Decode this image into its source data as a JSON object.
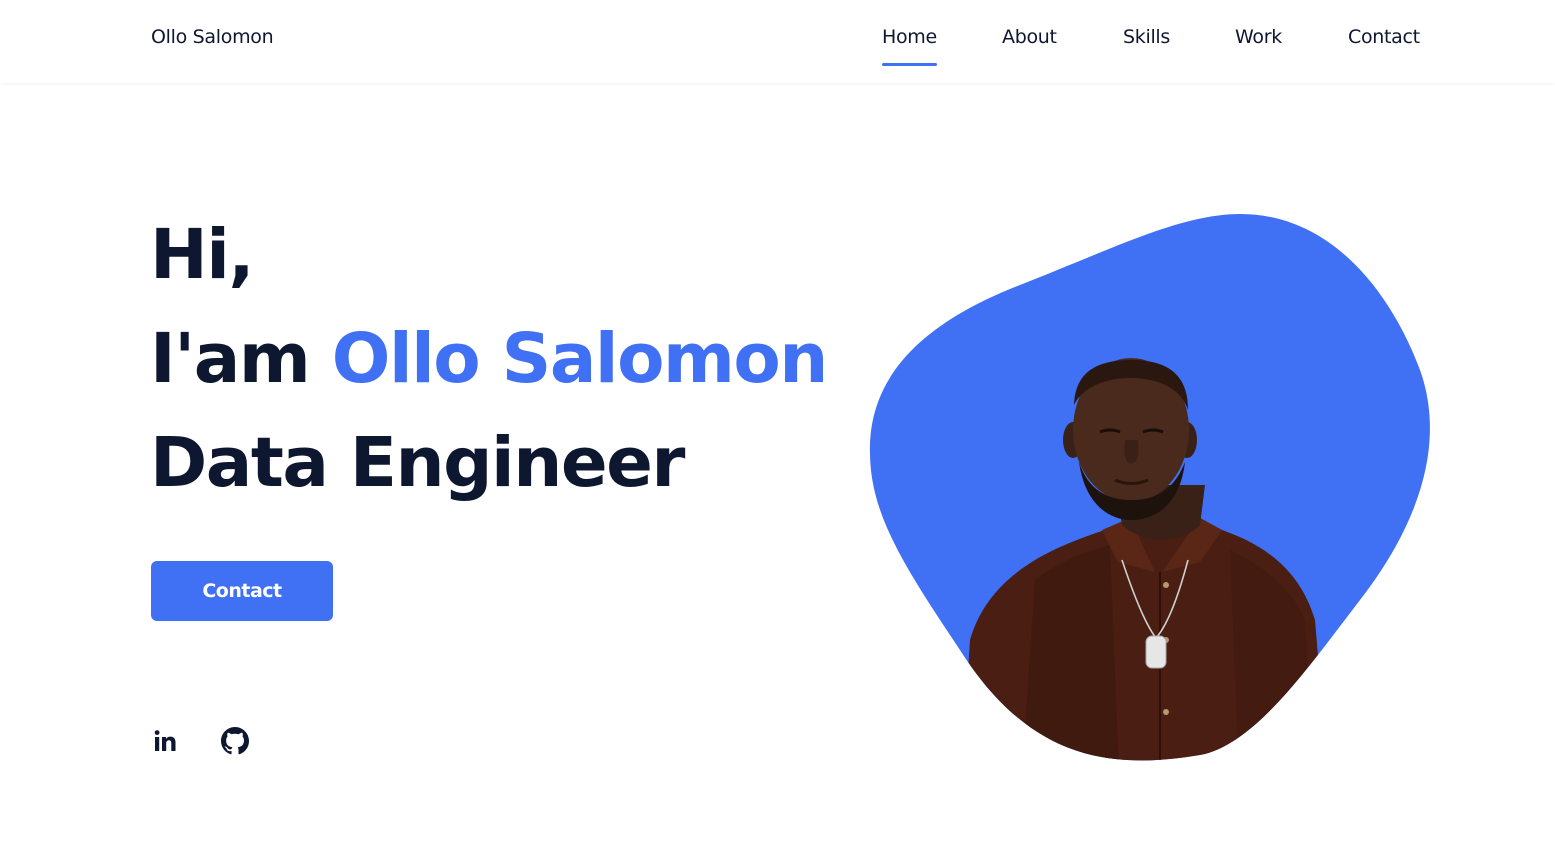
{
  "header": {
    "logo": "Ollo Salomon",
    "nav": [
      {
        "label": "Home",
        "active": true
      },
      {
        "label": "About",
        "active": false
      },
      {
        "label": "Skills",
        "active": false
      },
      {
        "label": "Work",
        "active": false
      },
      {
        "label": "Contact",
        "active": false
      }
    ]
  },
  "hero": {
    "line1": "Hi,",
    "line2_prefix": "I'am ",
    "line2_name": "Ollo Salomon",
    "line3": "Data Engineer",
    "button_label": "Contact",
    "social": [
      {
        "icon": "linkedin-icon",
        "label": "in"
      },
      {
        "icon": "github-icon"
      }
    ],
    "image": {
      "description": "portrait",
      "blob_color": "#4070f4"
    }
  },
  "colors": {
    "accent": "#4070f4",
    "text": "#0e1730",
    "background": "#ffffff"
  }
}
